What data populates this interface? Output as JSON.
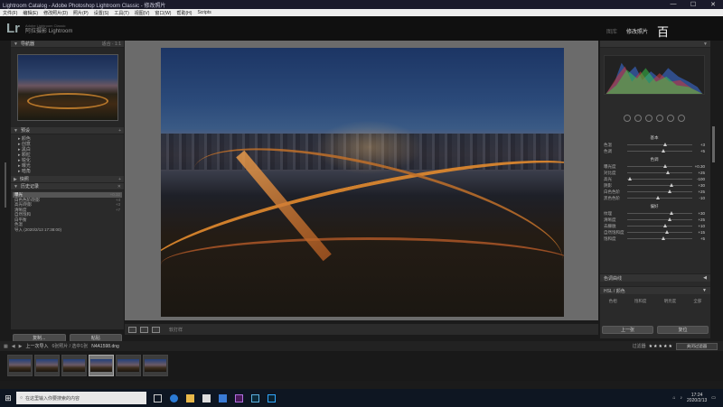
{
  "window": {
    "title": "Lightroom Catalog - Adobe Photoshop Lightroom Classic - 修改照片",
    "min": "—",
    "max": "☐",
    "close": "✕"
  },
  "menu": [
    "文件(F)",
    "编辑(E)",
    "修改照片(D)",
    "照片(P)",
    "设置(S)",
    "工具(T)",
    "视图(V)",
    "窗口(W)",
    "帮助(H)",
    "Scripts"
  ],
  "identity": {
    "logo": "Lr",
    "small": "Adobe Lightroom Classic",
    "catalog": "阿拉摄影 Lightroom"
  },
  "modules": {
    "library": "图库",
    "develop": "修改照片",
    "overlay": "百"
  },
  "left": {
    "navigator": {
      "title": "导航器",
      "fit": "适合",
      "ratio": "1:1"
    },
    "presets": {
      "title": "预设",
      "items": [
        "颜色",
        "创意",
        "黑白",
        "颗粒",
        "锐化",
        "曝光",
        "暗角"
      ]
    },
    "snapshots": {
      "title": "快照"
    },
    "history": {
      "title": "历史记录",
      "items": [
        {
          "label": "曝光",
          "val": "+0.32",
          "v2": "0.32"
        },
        {
          "label": "白色色阶/阴影",
          "val": "+4",
          "v2": ""
        },
        {
          "label": "高光/阴影",
          "val": "+3",
          "v2": ""
        },
        {
          "label": "清晰度",
          "val": "+7",
          "v2": ""
        },
        {
          "label": "自然饱和",
          "val": "",
          "v2": ""
        },
        {
          "label": "白平衡",
          "val": "",
          "v2": ""
        },
        {
          "label": "色温",
          "val": "",
          "v2": ""
        },
        {
          "label": "导入 (2020/2/13 17:38:00)",
          "val": "",
          "v2": ""
        }
      ]
    },
    "copy_btn": "复制...",
    "paste_btn": "粘贴"
  },
  "center_toolbar": {
    "soft_proof": "软打样"
  },
  "right": {
    "histogram_labels": {
      "iso": "ISO",
      "lens": "f/",
      "shutter": "1/1"
    },
    "basic_title": "基本",
    "profile": "配置文件",
    "wb_label": "白平衡",
    "tone_title": "色调",
    "auto": "自动",
    "presence": "偏好",
    "sliders": [
      {
        "label": "色温",
        "val": "+3",
        "pos": 0.55
      },
      {
        "label": "色调",
        "val": "+5",
        "pos": 0.53
      },
      {
        "label": "曝光度",
        "val": "+0.30",
        "pos": 0.55
      },
      {
        "label": "对比度",
        "val": "+25",
        "pos": 0.6
      },
      {
        "label": "高光",
        "val": "-100",
        "pos": 0.02
      },
      {
        "label": "阴影",
        "val": "+30",
        "pos": 0.65
      },
      {
        "label": "白色色阶",
        "val": "+25",
        "pos": 0.62
      },
      {
        "label": "黑色色阶",
        "val": "-10",
        "pos": 0.45
      },
      {
        "label": "纹理",
        "val": "+30",
        "pos": 0.65
      },
      {
        "label": "清晰度",
        "val": "+25",
        "pos": 0.62
      },
      {
        "label": "去朦胧",
        "val": "+10",
        "pos": 0.55
      },
      {
        "label": "自然饱和度",
        "val": "+15",
        "pos": 0.58
      },
      {
        "label": "饱和度",
        "val": "+5",
        "pos": 0.53
      }
    ],
    "tone_curve": "色调曲线",
    "hsl": "HSL / 颜色",
    "tabs": [
      "色相",
      "饱和度",
      "明亮度",
      "全部"
    ],
    "prev_btn": "上一张",
    "reset_btn": "复位"
  },
  "filmstrip": {
    "source": "上一次导入",
    "count": "6张照片 / 选中1张",
    "file": "N4A1598.dng",
    "filter_label": "过滤器",
    "stars": "★★★★★",
    "filter_box": "关闭过滤器",
    "thumb_count": 6
  },
  "taskbar": {
    "search": "在这里输入你要搜索的内容",
    "time": "17:24",
    "date": "2020/2/13"
  }
}
